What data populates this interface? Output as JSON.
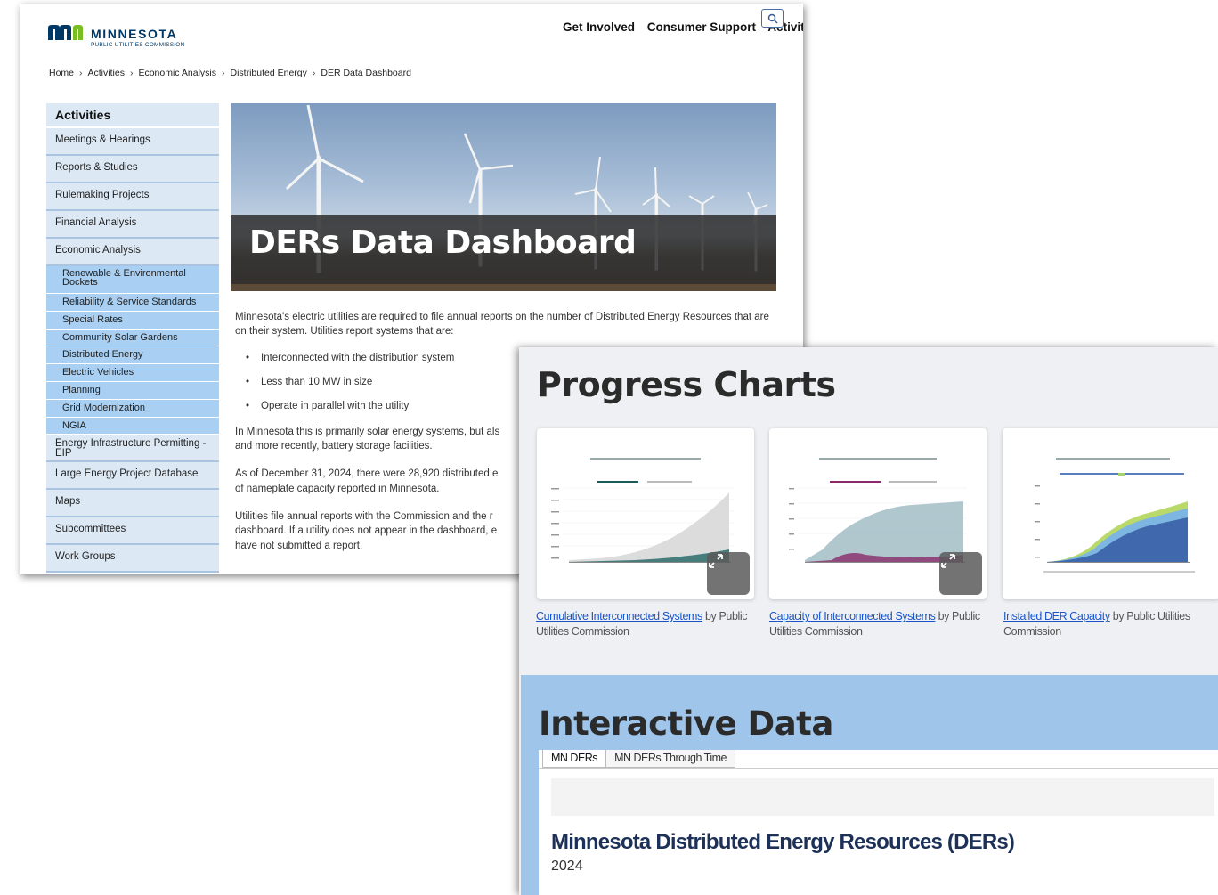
{
  "header": {
    "logo_name": "MINNESOTA",
    "logo_sub": "PUBLIC UTILITIES COMMISSION",
    "nav": [
      "Get Involved",
      "Consumer Support",
      "Activit"
    ]
  },
  "breadcrumb": [
    "Home",
    "Activities",
    "Economic Analysis",
    "Distributed Energy",
    "DER Data Dashboard"
  ],
  "sidebar": {
    "heading": "Activities",
    "items_top": [
      "Meetings & Hearings",
      "Reports & Studies",
      "Rulemaking Projects",
      "Financial Analysis",
      "Economic Analysis"
    ],
    "subitems": [
      "Renewable & Environmental Dockets",
      "Reliability & Service Standards",
      "Special Rates",
      "Community Solar Gardens",
      "Distributed Energy",
      "Electric Vehicles",
      "Planning",
      "Grid Modernization",
      "NGIA"
    ],
    "items_bottom": [
      "Energy Infrastructure Permitting - EIP",
      "Large Energy Project Database",
      "Maps",
      "Subcommittees",
      "Work Groups"
    ]
  },
  "hero": {
    "title": "DERs Data Dashboard"
  },
  "content": {
    "p1": "Minnesota's electric utilities are required to file annual reports on the number of Distributed Energy Resources that are on their system.  Utilities report systems that are:",
    "bullets": [
      "Interconnected with the distribution system",
      "Less than 10 MW in size",
      "Operate in parallel with the utility"
    ],
    "p2": "In Minnesota this is primarily solar energy systems, but als\nand more recently, battery storage facilities.",
    "p3": "As of December 31, 2024, there were 28,920 distributed e\nof nameplate capacity reported in Minnesota.",
    "p4": "Utilities file annual reports with the Commission and the r\ndashboard. If a utility does not appear in the dashboard, e\nhave not submitted a report."
  },
  "progress": {
    "title": "Progress Charts",
    "cards": [
      {
        "link": "Cumulative Interconnected Systems",
        "rest": " by Public Utilities Commission"
      },
      {
        "link": "Capacity of Interconnected Systems",
        "rest": " by Public Utilities Commission"
      },
      {
        "link": "Installed DER Capacity",
        "rest": " by Public Utilities Commission"
      }
    ]
  },
  "interactive": {
    "title": "Interactive Data",
    "tabs": [
      "MN DERs",
      "MN DERs Through Time"
    ],
    "der_title": "Minnesota Distributed Energy Resources (DERs)",
    "year": "2024"
  },
  "colors": {
    "sidebar_bg": "#dce9f5",
    "sidebar_sub_bg": "#a9d0f2",
    "interactive_bg": "#9fc6ea",
    "link": "#1a55c9",
    "der_title": "#1d3158"
  }
}
